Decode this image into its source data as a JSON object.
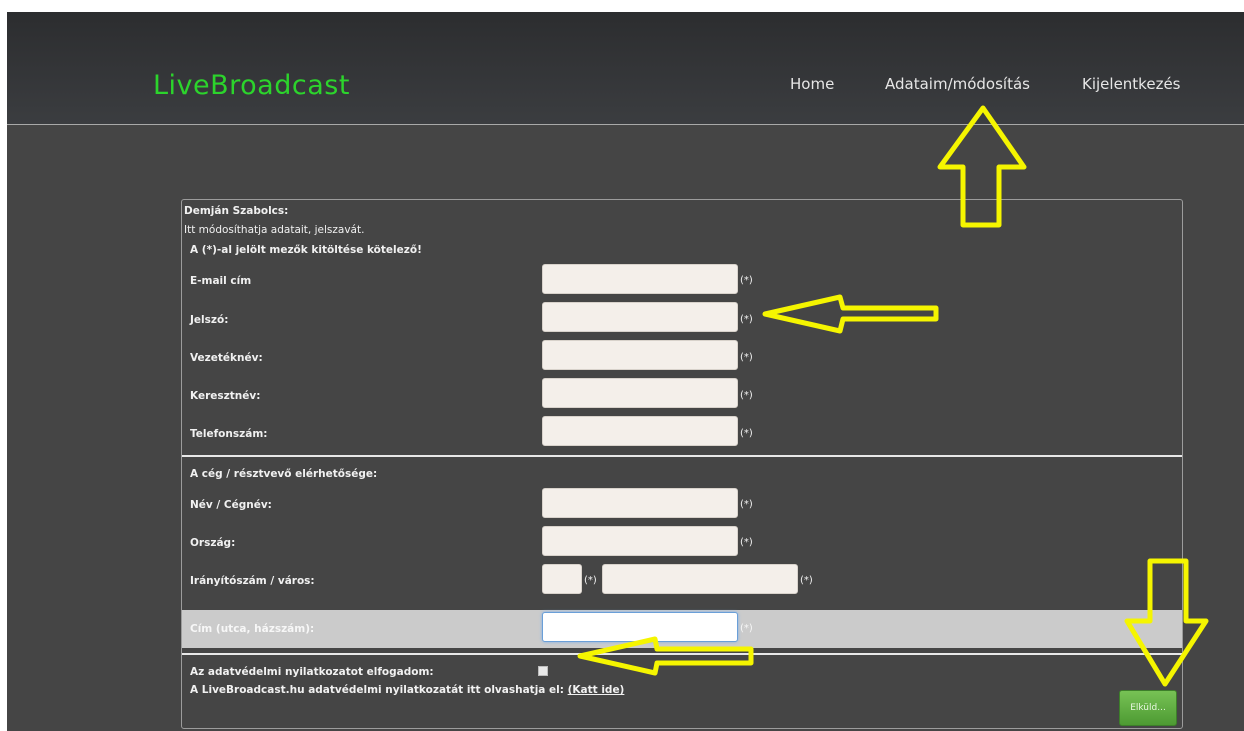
{
  "header": {
    "logo": "LiveBroadcast",
    "nav": [
      {
        "label": "Home"
      },
      {
        "label": "Adataim/módosítás"
      },
      {
        "label": "Kijelentkezés"
      }
    ]
  },
  "form": {
    "user_name": "Demján Szabolcs:",
    "intro": "Itt módosíthatja adatait, jelszavát.",
    "required_note": "A (*)-al jelölt mezők kitöltése kötelező!",
    "required_marker": "(*)",
    "fields": [
      {
        "label": "E-mail cím",
        "value": ""
      },
      {
        "label": "Jelszó:",
        "value": ""
      },
      {
        "label": "Vezetéknév:",
        "value": ""
      },
      {
        "label": "Keresztnév:",
        "value": ""
      },
      {
        "label": "Telefonszám:",
        "value": ""
      }
    ],
    "company_section": "A cég / résztvevő elérhetősége:",
    "company_fields": [
      {
        "label": "Név / Cégnév:",
        "value": ""
      },
      {
        "label": "Ország:",
        "value": ""
      },
      {
        "label": "Irányítószám / város:",
        "value": ""
      },
      {
        "label": "Cím (utca, házszám):",
        "value": ""
      }
    ],
    "privacy_accept": "Az adatvédelmi nyilatkozatot elfogadom:",
    "privacy_read": "A LiveBroadcast.hu adatvédelmi nyilatkozatát itt olvashatja el:",
    "privacy_link": "(Katt ide)",
    "submit": "Elküld..."
  },
  "colors": {
    "logo": "#2cd42c",
    "annotation_arrow": "#f5f500",
    "submit_button": "#5daa3f"
  }
}
